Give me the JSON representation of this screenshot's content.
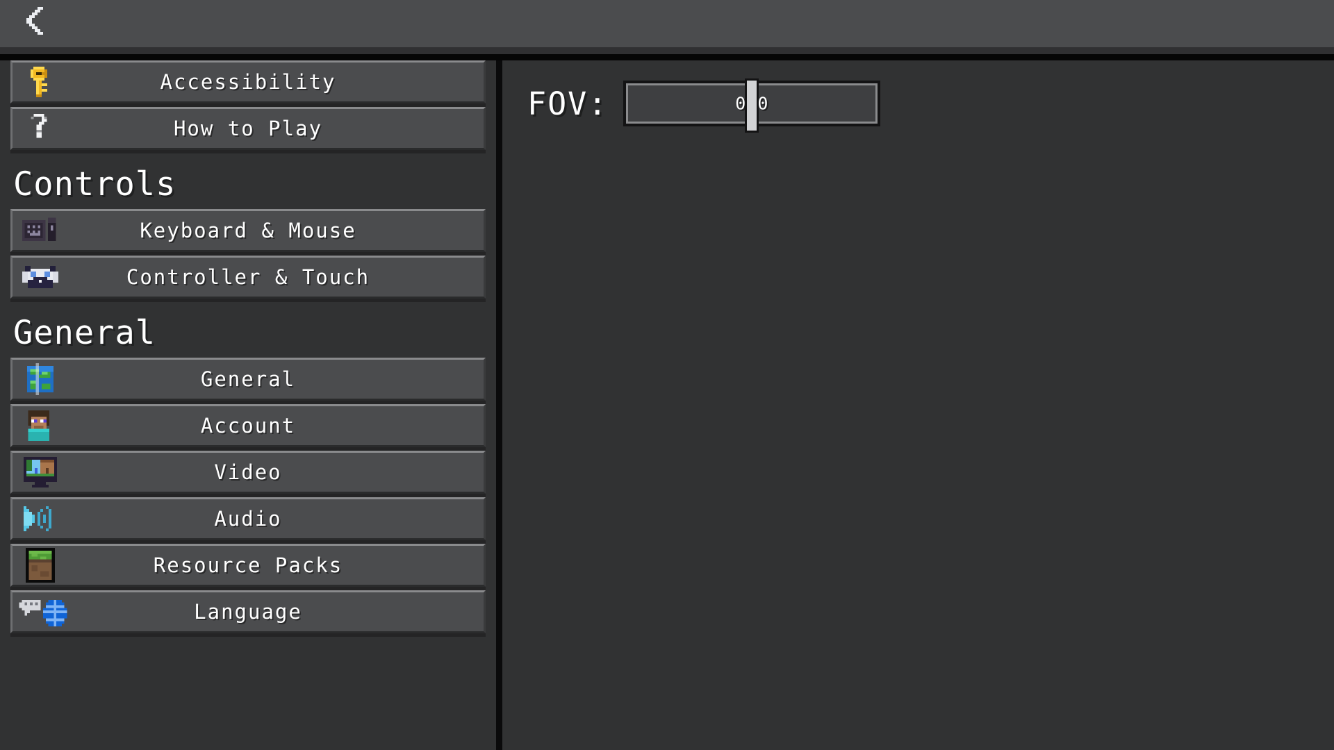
{
  "topbar": {
    "back_label": "Back",
    "back_icon": "chevron-left-icon"
  },
  "sidebar": {
    "groups": [
      {
        "header": null,
        "items": [
          {
            "label": "Accessibility",
            "icon": "gold-key-icon"
          },
          {
            "label": "How to Play",
            "icon": "question-mark-icon"
          }
        ]
      },
      {
        "header": "Controls",
        "items": [
          {
            "label": "Keyboard & Mouse",
            "icon": "keyboard-mouse-icon"
          },
          {
            "label": "Controller & Touch",
            "icon": "gamepad-icon"
          }
        ]
      },
      {
        "header": "General",
        "items": [
          {
            "label": "General",
            "icon": "globe-cube-icon"
          },
          {
            "label": "Account",
            "icon": "steve-head-icon"
          },
          {
            "label": "Video",
            "icon": "monitor-icon"
          },
          {
            "label": "Audio",
            "icon": "speaker-icon"
          },
          {
            "label": "Resource Packs",
            "icon": "grass-block-icon"
          },
          {
            "label": "Language",
            "icon": "chat-globe-icon"
          }
        ]
      }
    ]
  },
  "panel": {
    "fov": {
      "label": "FOV:",
      "value": "0.0",
      "value_number": 0.0,
      "handle_percent": 50
    }
  },
  "colors": {
    "background": "#313233",
    "topbar": "#4b4c4e",
    "button_face": "#4b4c4e",
    "button_highlight": "#8a8b8d",
    "button_shadow": "#242425",
    "text": "#ffffff",
    "slider_handle": "#d2d3d5",
    "divider": "#0a0a0b"
  }
}
